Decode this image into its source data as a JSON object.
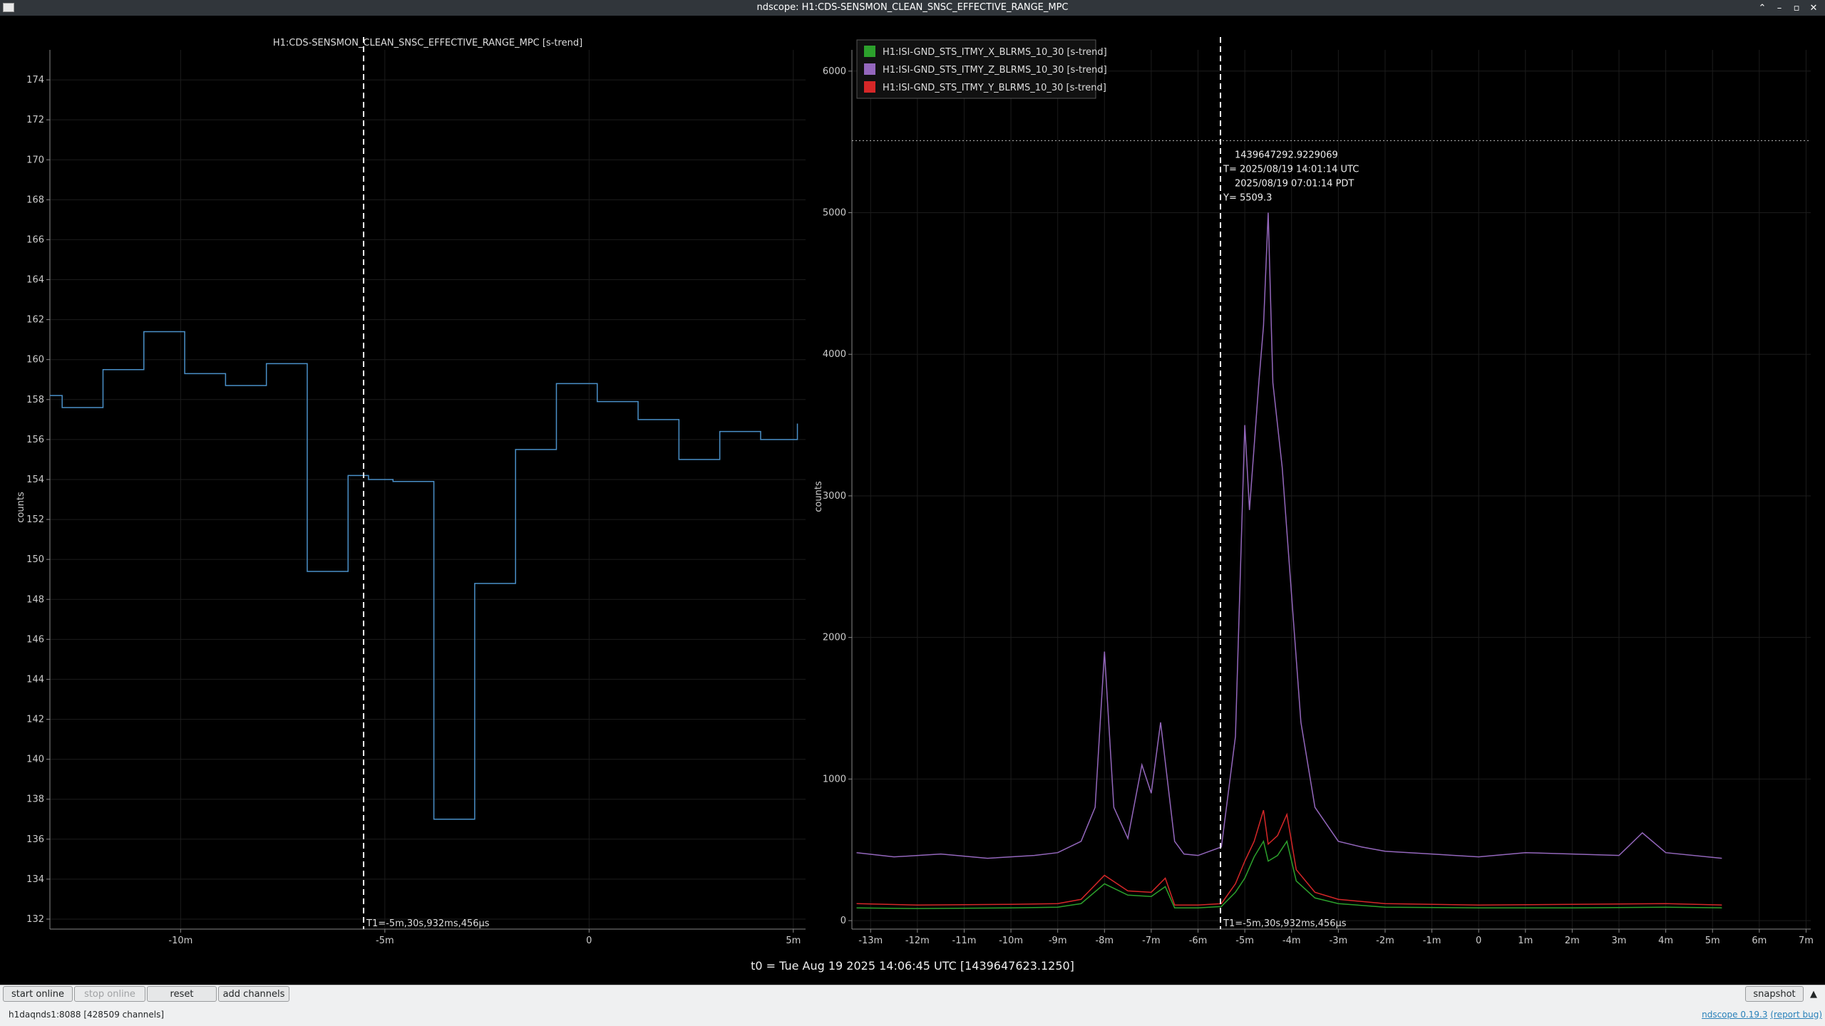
{
  "window": {
    "title": "ndscope: H1:CDS-SENSMON_CLEAN_SNSC_EFFECTIVE_RANGE_MPC",
    "buttons": [
      "⌃",
      "–",
      "▫",
      "✕"
    ]
  },
  "left_plot": {
    "title": "H1:CDS-SENSMON_CLEAN_SNSC_EFFECTIVE_RANGE_MPC [s-trend]",
    "ylabel": "counts",
    "cursor_label": "T1=-5m,30s,932ms,456μs",
    "color": "#4a90c8"
  },
  "right_plot": {
    "ylabel": "counts",
    "cursor_label": "T1=-5m,30s,932ms,456μs",
    "crosshair": {
      "gps": "1439647292.9229069",
      "utc": "T= 2025/08/19 14:01:14 UTC",
      "pdt": "2025/08/19 07:01:14 PDT",
      "y": "Y= 5509.3"
    },
    "legend": [
      {
        "name": "H1:ISI-GND_STS_ITMY_X_BLRMS_10_30 [s-trend]",
        "color": "#2ca02c"
      },
      {
        "name": "H1:ISI-GND_STS_ITMY_Z_BLRMS_10_30 [s-trend]",
        "color": "#9467bd"
      },
      {
        "name": "H1:ISI-GND_STS_ITMY_Y_BLRMS_10_30 [s-trend]",
        "color": "#d62728"
      }
    ]
  },
  "t0_label": "t0 = Tue Aug 19 2025 14:06:45 UTC [1439647623.1250]",
  "toolbar": {
    "start_online": "start online",
    "stop_online": "stop online",
    "reset": "reset",
    "add_channels": "add channels",
    "snapshot": "snapshot",
    "arrow": "▲"
  },
  "status": {
    "server": "h1daqnds1:8088  [428509 channels]",
    "version_link": "ndscope 0.19.3",
    "bug_link": "(report bug)"
  },
  "chart_data": [
    {
      "type": "line",
      "title": "H1:CDS-SENSMON_CLEAN_SNSC_EFFECTIVE_RANGE_MPC [s-trend]",
      "xlabel": "",
      "ylabel": "counts",
      "x_unit": "minutes relative to t0",
      "xlim": [
        -13.2,
        5.3
      ],
      "ylim": [
        131.5,
        175.5
      ],
      "xticks": [
        -10,
        -5,
        0,
        5
      ],
      "xtick_labels": [
        "-10m",
        "-5m",
        "0",
        "5m"
      ],
      "yticks": [
        132,
        134,
        136,
        138,
        140,
        142,
        144,
        146,
        148,
        150,
        152,
        154,
        156,
        158,
        160,
        162,
        164,
        166,
        168,
        170,
        172,
        174
      ],
      "grid": true,
      "cursor_x": -5.52,
      "series": [
        {
          "name": "H1:CDS-SENSMON_CLEAN_SNSC_EFFECTIVE_RANGE_MPC [s-trend]",
          "step": true,
          "x": [
            -13.3,
            -12.9,
            -11.9,
            -10.9,
            -9.9,
            -8.9,
            -7.9,
            -6.9,
            -5.9,
            -5.4,
            -4.8,
            -3.8,
            -2.8,
            -1.8,
            -0.8,
            0.2,
            1.2,
            2.2,
            3.2,
            4.2,
            5.1
          ],
          "y": [
            158.2,
            157.6,
            159.5,
            161.4,
            159.3,
            158.7,
            159.8,
            149.4,
            154.2,
            154.0,
            153.9,
            137.0,
            148.8,
            155.5,
            158.8,
            157.9,
            157.0,
            155.0,
            156.4,
            156.0,
            156.8
          ]
        }
      ]
    },
    {
      "type": "line",
      "xlabel": "",
      "ylabel": "counts",
      "x_unit": "minutes relative to t0",
      "xlim": [
        -13.4,
        7.1
      ],
      "ylim": [
        -60,
        6150
      ],
      "xticks": [
        -13,
        -12,
        -11,
        -10,
        -9,
        -8,
        -7,
        -6,
        -5,
        -4,
        -3,
        -2,
        -1,
        0,
        1,
        2,
        3,
        4,
        5,
        6,
        7
      ],
      "xtick_labels": [
        "-13m",
        "-12m",
        "-11m",
        "-10m",
        "-9m",
        "-8m",
        "-7m",
        "-6m",
        "-5m",
        "-4m",
        "-3m",
        "-2m",
        "-1m",
        "0",
        "1m",
        "2m",
        "3m",
        "4m",
        "5m",
        "6m",
        "7m"
      ],
      "yticks": [
        0,
        1000,
        2000,
        3000,
        4000,
        5000,
        6000
      ],
      "grid": true,
      "cursor_x": -5.52,
      "crosshair_y": 5509.3,
      "series": [
        {
          "name": "H1:ISI-GND_STS_ITMY_Z_BLRMS_10_30 [s-trend]",
          "x": [
            -13.3,
            -12.5,
            -11.5,
            -10.5,
            -9.5,
            -9.0,
            -8.5,
            -8.2,
            -8.0,
            -7.8,
            -7.5,
            -7.2,
            -7.0,
            -6.8,
            -6.5,
            -6.3,
            -6.0,
            -5.5,
            -5.2,
            -5.0,
            -4.9,
            -4.7,
            -4.6,
            -4.5,
            -4.4,
            -4.2,
            -4.0,
            -3.8,
            -3.5,
            -3.0,
            -2.5,
            -2.0,
            -1.0,
            0.0,
            1.0,
            2.0,
            3.0,
            3.5,
            4.0,
            5.2
          ],
          "y": [
            480,
            450,
            470,
            440,
            460,
            480,
            560,
            800,
            1900,
            800,
            580,
            1100,
            900,
            1400,
            560,
            470,
            460,
            520,
            1300,
            3500,
            2900,
            3800,
            4200,
            5000,
            3800,
            3200,
            2300,
            1400,
            800,
            560,
            520,
            490,
            470,
            450,
            480,
            470,
            460,
            620,
            480,
            440
          ]
        },
        {
          "name": "H1:ISI-GND_STS_ITMY_Y_BLRMS_10_30 [s-trend]",
          "x": [
            -13.3,
            -12,
            -10,
            -9,
            -8.5,
            -8.0,
            -7.5,
            -7.0,
            -6.7,
            -6.5,
            -6.0,
            -5.5,
            -5.2,
            -5.0,
            -4.8,
            -4.6,
            -4.5,
            -4.3,
            -4.1,
            -3.9,
            -3.5,
            -3.0,
            -2.0,
            0.0,
            2.0,
            4.0,
            5.2
          ],
          "y": [
            120,
            110,
            115,
            120,
            150,
            320,
            210,
            200,
            300,
            110,
            110,
            120,
            260,
            420,
            560,
            780,
            540,
            600,
            750,
            360,
            200,
            150,
            120,
            110,
            115,
            120,
            110
          ]
        },
        {
          "name": "H1:ISI-GND_STS_ITMY_X_BLRMS_10_30 [s-trend]",
          "x": [
            -13.3,
            -12,
            -10,
            -9,
            -8.5,
            -8.0,
            -7.5,
            -7.0,
            -6.7,
            -6.5,
            -6.0,
            -5.5,
            -5.2,
            -5.0,
            -4.8,
            -4.6,
            -4.5,
            -4.3,
            -4.1,
            -3.9,
            -3.5,
            -3.0,
            -2.0,
            0.0,
            2.0,
            4.0,
            5.2
          ],
          "y": [
            90,
            85,
            90,
            95,
            120,
            260,
            180,
            170,
            240,
            90,
            90,
            100,
            200,
            300,
            450,
            560,
            420,
            460,
            560,
            280,
            160,
            120,
            95,
            90,
            90,
            95,
            90
          ]
        }
      ]
    }
  ]
}
